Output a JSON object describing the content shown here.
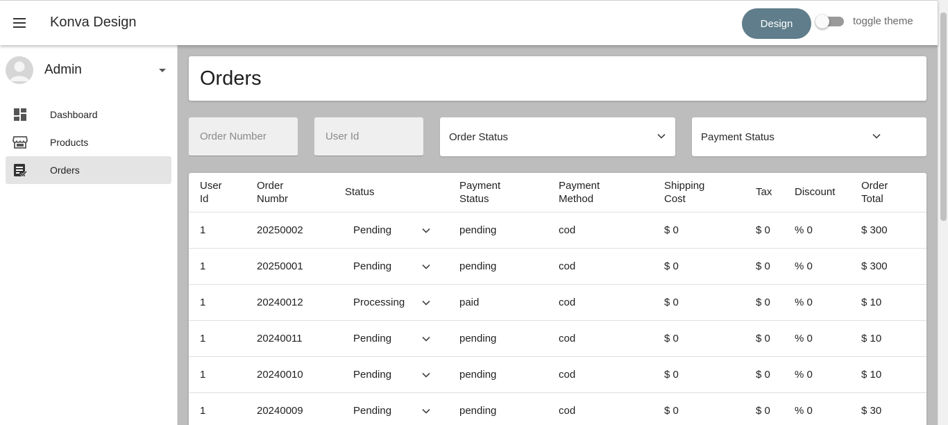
{
  "app": {
    "title": "Konva Design",
    "design_label": "Design",
    "toggle_label": "toggle theme"
  },
  "sidebar": {
    "user_name": "Admin",
    "items": [
      {
        "label": "Dashboard",
        "icon": "dashboard-icon",
        "active": false
      },
      {
        "label": "Products",
        "icon": "storefront-icon",
        "active": false
      },
      {
        "label": "Orders",
        "icon": "orders-icon",
        "active": true
      }
    ]
  },
  "page": {
    "title": "Orders"
  },
  "filters": {
    "order_number_placeholder": "Order Number",
    "user_id_placeholder": "User Id",
    "order_status_label": "Order Status",
    "payment_status_label": "Payment Status"
  },
  "table": {
    "headers": {
      "user_id": [
        "User",
        "Id"
      ],
      "order_number": [
        "Order",
        "Numbr"
      ],
      "status": [
        "Status"
      ],
      "payment_status": [
        "Payment",
        "Status"
      ],
      "payment_method": [
        "Payment",
        "Method"
      ],
      "shipping_cost": [
        "Shipping",
        "Cost"
      ],
      "tax": [
        "Tax"
      ],
      "discount": [
        "Discount"
      ],
      "order_total": [
        "Order",
        "Total"
      ]
    },
    "rows": [
      {
        "user_id": "1",
        "order_number": "20250002",
        "status": "Pending",
        "payment_status": "pending",
        "payment_method": "cod",
        "shipping_cost": "$ 0",
        "tax": "$ 0",
        "discount": "% 0",
        "order_total": "$ 300"
      },
      {
        "user_id": "1",
        "order_number": "20250001",
        "status": "Pending",
        "payment_status": "pending",
        "payment_method": "cod",
        "shipping_cost": "$ 0",
        "tax": "$ 0",
        "discount": "% 0",
        "order_total": "$ 300"
      },
      {
        "user_id": "1",
        "order_number": "20240012",
        "status": "Processing",
        "payment_status": "paid",
        "payment_method": "cod",
        "shipping_cost": "$ 0",
        "tax": "$ 0",
        "discount": "% 0",
        "order_total": "$ 10"
      },
      {
        "user_id": "1",
        "order_number": "20240011",
        "status": "Pending",
        "payment_status": "pending",
        "payment_method": "cod",
        "shipping_cost": "$ 0",
        "tax": "$ 0",
        "discount": "% 0",
        "order_total": "$ 10"
      },
      {
        "user_id": "1",
        "order_number": "20240010",
        "status": "Pending",
        "payment_status": "pending",
        "payment_method": "cod",
        "shipping_cost": "$ 0",
        "tax": "$ 0",
        "discount": "% 0",
        "order_total": "$ 10"
      },
      {
        "user_id": "1",
        "order_number": "20240009",
        "status": "Pending",
        "payment_status": "pending",
        "payment_method": "cod",
        "shipping_cost": "$ 0",
        "tax": "$ 0",
        "discount": "% 0",
        "order_total": "$ 30"
      }
    ]
  },
  "colors": {
    "design_button": "#5f7d8a",
    "main_background": "#bdbdbd",
    "active_nav": "#e4e4e4"
  }
}
